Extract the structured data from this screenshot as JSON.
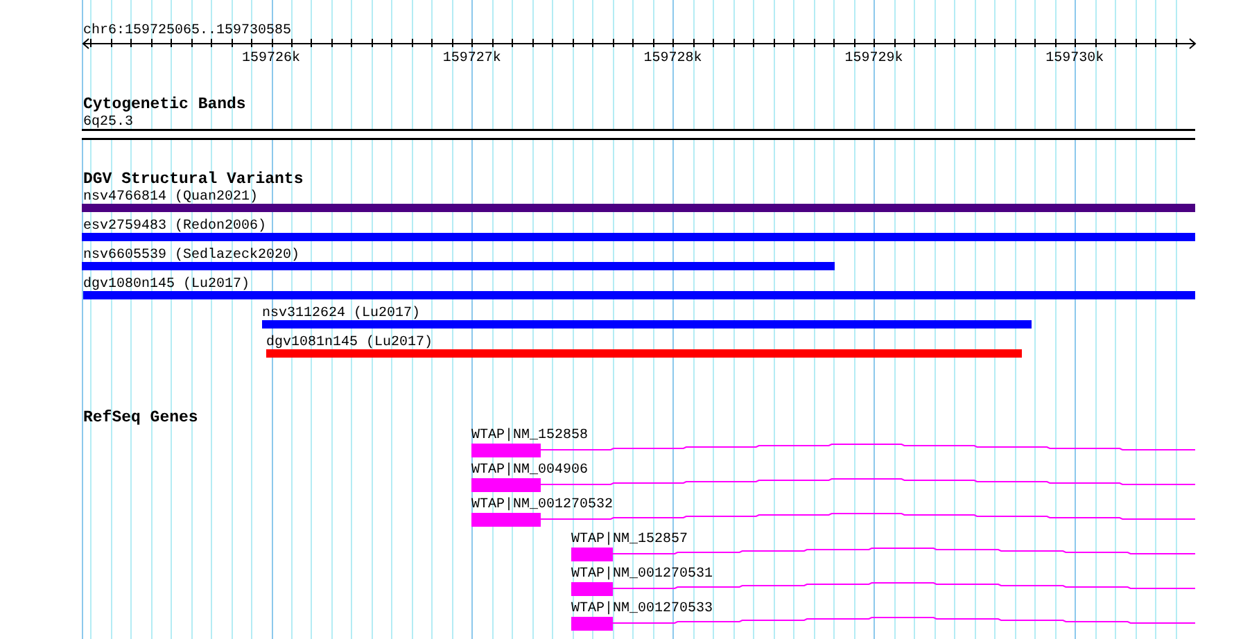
{
  "ruler": {
    "region": "chr6:159725065..159730585",
    "ticks": [
      "159726k",
      "159727k",
      "159728k",
      "159729k",
      "159730k"
    ]
  },
  "tracks": [
    {
      "kind": "cytoband",
      "title": "Cytogenetic Bands",
      "band": "6q25.3"
    },
    {
      "kind": "variants",
      "title": "DGV Structural Variants",
      "features": [
        {
          "label": "nsv4766814 (Quan2021)",
          "color": "#4b0082"
        },
        {
          "label": "esv2759483 (Redon2006)",
          "color": "#0000ff"
        },
        {
          "label": "nsv6605539 (Sedlazeck2020)",
          "color": "#0000ff"
        },
        {
          "label": "dgv1080n145 (Lu2017)",
          "color": "#0000ff"
        },
        {
          "label": "nsv3112624 (Lu2017)",
          "color": "#0000ff"
        },
        {
          "label": "dgv1081n145 (Lu2017)",
          "color": "#ff0000"
        }
      ]
    },
    {
      "kind": "genes",
      "title": "RefSeq Genes",
      "features": [
        {
          "label": "WTAP|NM_152858"
        },
        {
          "label": "WTAP|NM_004906"
        },
        {
          "label": "WTAP|NM_001270532"
        },
        {
          "label": "WTAP|NM_152857"
        },
        {
          "label": "WTAP|NM_001270531"
        },
        {
          "label": "WTAP|NM_001270533"
        }
      ]
    }
  ]
}
